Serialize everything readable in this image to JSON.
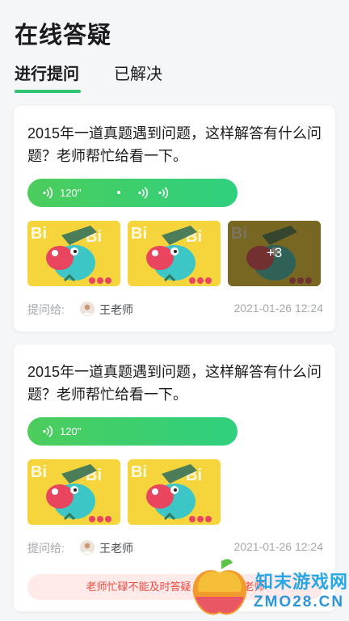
{
  "page": {
    "title": "在线答疑"
  },
  "tabs": [
    {
      "label": "进行提问",
      "active": true
    },
    {
      "label": "已解决",
      "active": false
    }
  ],
  "accent_color": "#2fc46f",
  "cards": [
    {
      "question": "2015年一道真题遇到问题，这样解答有什么问题？老师帮忙给看一下。",
      "voice_duration": "120''",
      "image_count_visible": 3,
      "more_images": "+3",
      "ask_to_label": "提问给:",
      "teacher": "王老师",
      "time": "2021-01-26 12:24"
    },
    {
      "question": "2015年一道真题遇到问题，这样解答有什么问题？老师帮忙给看一下。",
      "voice_duration": "120''",
      "image_count_visible": 2,
      "ask_to_label": "提问给:",
      "teacher": "王老师",
      "time": "2021-01-26 12:24",
      "notice": "老师忙碌不能及时答疑，可以提问老师"
    }
  ],
  "watermark": {
    "name": "知末游戏网",
    "url": "ZMO28.CN"
  }
}
